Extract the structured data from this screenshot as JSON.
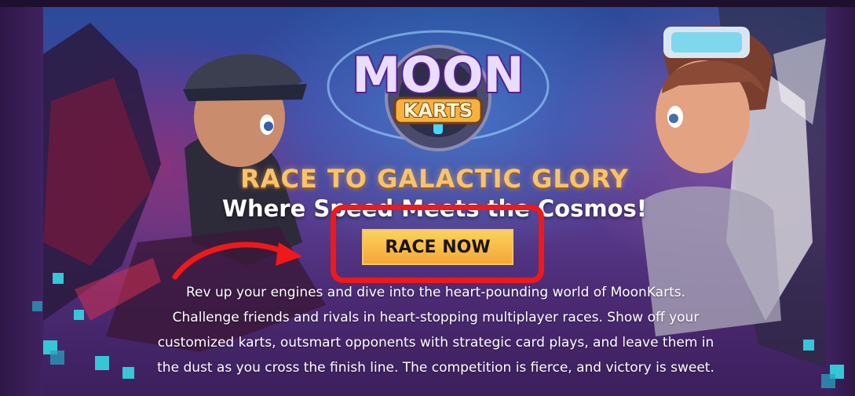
{
  "hero": {
    "logo": {
      "line1": "MOON",
      "line2": "KARTS"
    },
    "headline": "RACE TO GALACTIC GLORY",
    "subheadline": "Where Speed Meets the Cosmos!",
    "cta_label": "RACE NOW",
    "description": "Rev up your engines and dive into the heart-pounding world of MoonKarts. Challenge friends and rivals in heart-stopping multiplayer races. Show off your customized karts, outsmart opponents with strategic card plays, and leave them in the dust as you cross the finish line. The competition is fierce, and victory is sweet."
  },
  "colors": {
    "accent_gold": "#f7c46c",
    "button_top": "#fbd25c",
    "button_bottom": "#f5a63a",
    "annotation_red": "#f01818",
    "pixel_cyan": "#35c6d8",
    "background_purple": "#3a1e58"
  },
  "icons": [
    "moon-karts-logo",
    "annotation-arrow-icon",
    "pixel-decoration"
  ]
}
